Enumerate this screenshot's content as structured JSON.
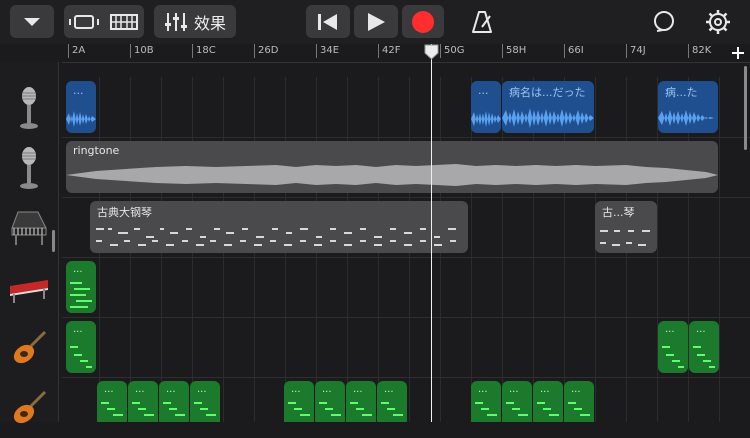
{
  "toolbar": {
    "fx_label": "效果"
  },
  "ruler": {
    "markers": [
      "2A",
      "10B",
      "18C",
      "26D",
      "34E",
      "42F",
      "50G",
      "58H",
      "66I",
      "74J",
      "82K"
    ]
  },
  "tracks": [
    {
      "instrument": "microphone",
      "regions": [
        {
          "label": "..."
        },
        {
          "label": "..."
        },
        {
          "label": "病名は...だった"
        },
        {
          "label": "病...た"
        }
      ]
    },
    {
      "instrument": "microphone",
      "regions": [
        {
          "label": "ringtone"
        }
      ]
    },
    {
      "instrument": "grand-piano",
      "regions": [
        {
          "label": "古典大钢琴"
        },
        {
          "label": "古...琴"
        }
      ]
    },
    {
      "instrument": "keyboard-synth",
      "regions": [
        {
          "label": "..."
        }
      ]
    },
    {
      "instrument": "electric-guitar",
      "regions": [
        {
          "label": "..."
        },
        {
          "label": "..."
        },
        {
          "label": "..."
        }
      ]
    },
    {
      "instrument": "electric-guitar",
      "regions": [
        {
          "label": "..."
        },
        {
          "label": "..."
        },
        {
          "label": "..."
        },
        {
          "label": "..."
        },
        {
          "label": "..."
        },
        {
          "label": "..."
        },
        {
          "label": "..."
        },
        {
          "label": "..."
        },
        {
          "label": "..."
        },
        {
          "label": "..."
        },
        {
          "label": "..."
        },
        {
          "label": "..."
        }
      ]
    }
  ],
  "colors": {
    "record": "#ff2d2d",
    "audio_region": "#1f4f8e",
    "loop_region": "#4a4a4c",
    "midi_region": "#1c7a2c"
  },
  "icons": {
    "tracks_view": "dropdown-triangle-icon",
    "browser": "browser-view-icon",
    "tracks": "tracks-view-icon",
    "mixer": "mixer-sliders-icon",
    "rewind": "go-to-beginning-icon",
    "play": "play-icon",
    "record": "record-icon",
    "metronome": "metronome-icon",
    "loop": "loop-browser-icon",
    "settings": "settings-gear-icon"
  }
}
